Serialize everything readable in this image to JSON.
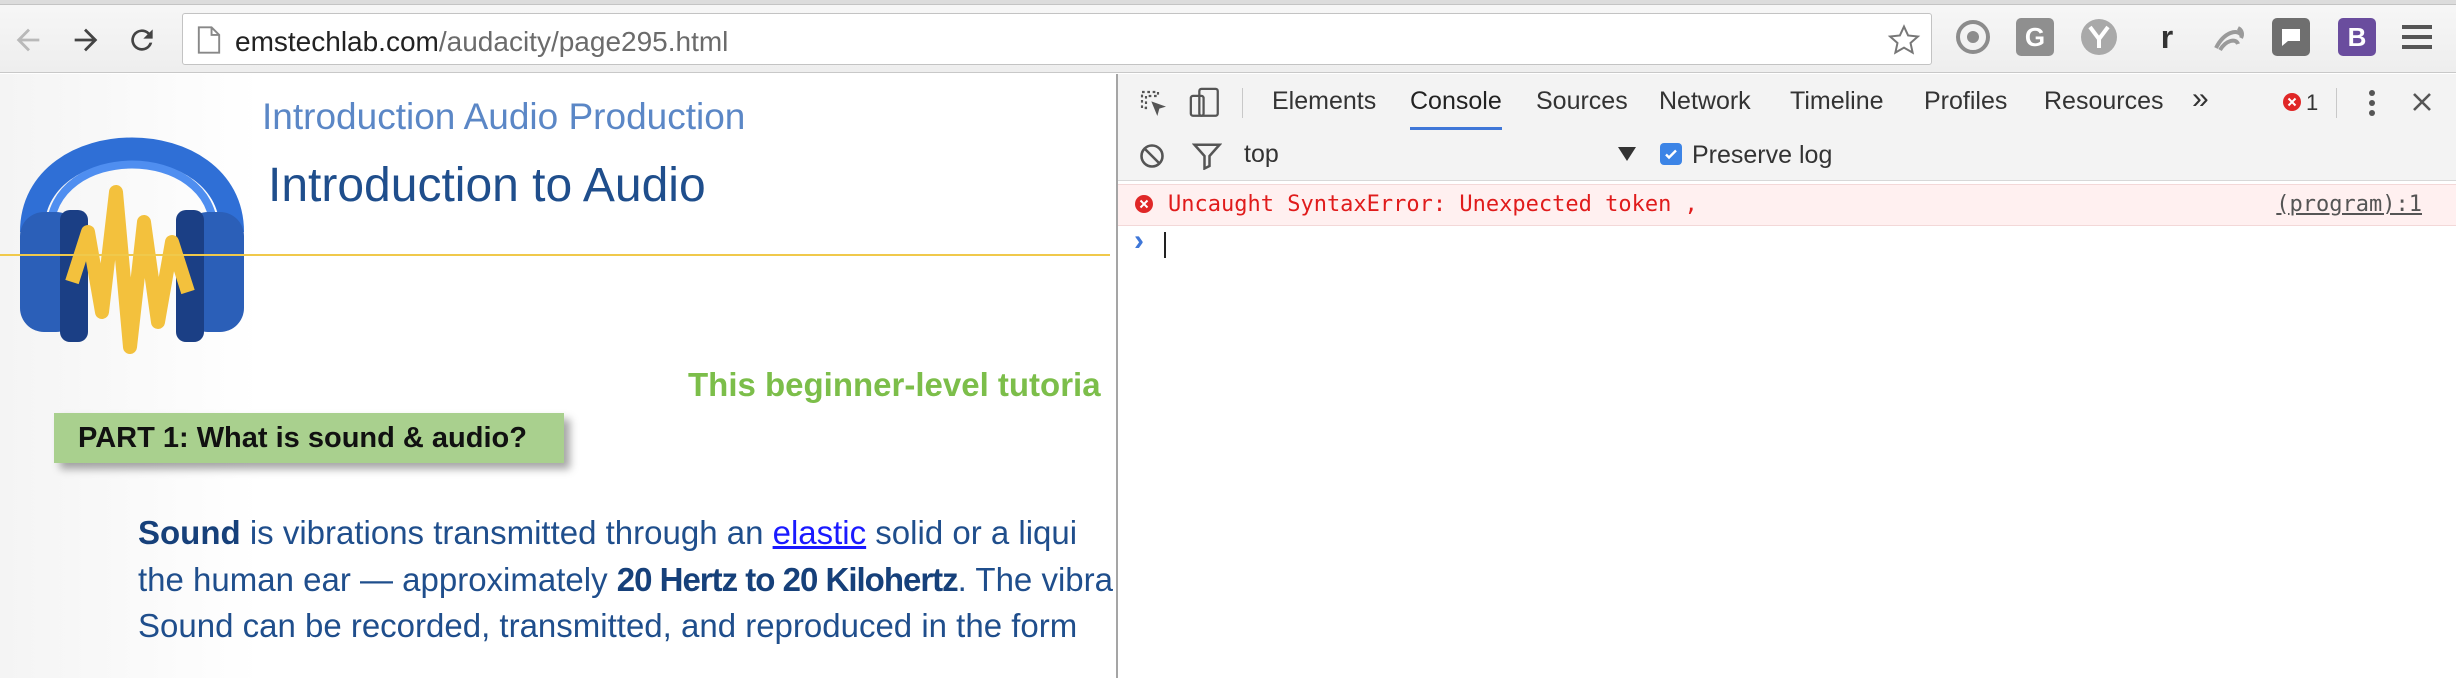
{
  "browser": {
    "url_domain": "emstechlab.com",
    "url_path": "/audacity/page295.html",
    "icons": [
      "back-icon",
      "forward-icon",
      "reload-icon",
      "page-icon",
      "bookmark-star-icon",
      "menu-icon"
    ],
    "extensions": [
      {
        "name": "circle-extension-icon",
        "label": ""
      },
      {
        "name": "g-extension-icon",
        "label": "G"
      },
      {
        "name": "y-extension-icon",
        "label": ""
      },
      {
        "name": "r-extension-icon",
        "label": "r"
      },
      {
        "name": "swirl-extension-icon",
        "label": ""
      },
      {
        "name": "chat-extension-icon",
        "label": ""
      },
      {
        "name": "b-extension-icon",
        "label": "B"
      }
    ]
  },
  "page": {
    "site_title": "Introduction Audio Production",
    "heading": "Introduction to Audio",
    "intro": "This beginner-level tutoria",
    "part_title": "PART 1: What is sound & audio?",
    "para": {
      "l1_bold": "Sound",
      "l1_a": " is vibrations transmitted through an ",
      "l1_link": "elastic",
      "l1_b": " solid or a liqui",
      "l2_a": "the human ear — approximately ",
      "l2_bold": "20 Hertz to 20 Kilohertz",
      "l2_b": ".  The vibra",
      "l3": "Sound can be recorded, transmitted, and reproduced in the form"
    },
    "colors": {
      "accent_blue": "#1f4e8c",
      "title_blue": "#5b87c6",
      "green": "#7cbe4a",
      "box_green": "#a9d08e",
      "rule_gold": "#f0c94b"
    }
  },
  "devtools": {
    "tabs": [
      "Elements",
      "Console",
      "Sources",
      "Network",
      "Timeline",
      "Profiles",
      "Resources"
    ],
    "active_tab": "Console",
    "more_tabs": "»",
    "error_count": "1",
    "context": "top",
    "preserve_log_label": "Preserve log",
    "preserve_log_checked": true,
    "error_message": "Uncaught SyntaxError: Unexpected token ,",
    "error_source": "(program):1",
    "prompt_symbol": "›",
    "colors": {
      "error_red": "#e01b1b",
      "error_bg": "#fff0f0",
      "tab_underline": "#3f77d8"
    }
  }
}
